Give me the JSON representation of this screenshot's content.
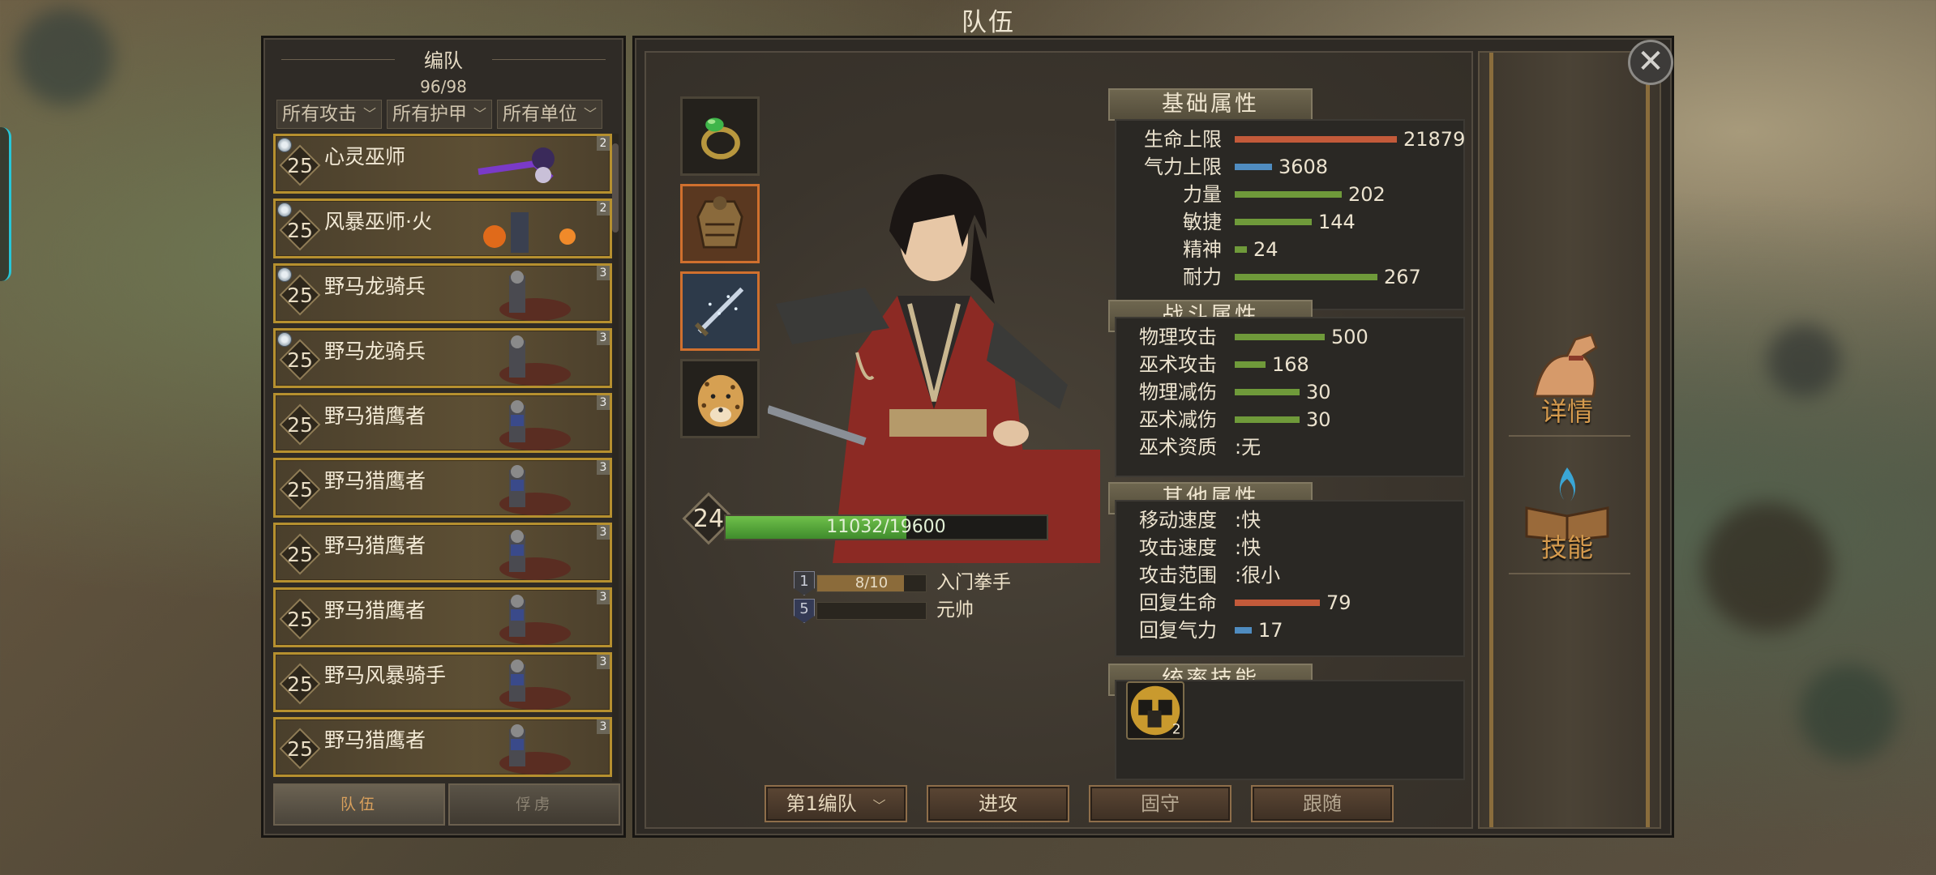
{
  "window_title": "队伍",
  "roster": {
    "title": "编队",
    "count": "96/98",
    "filters": [
      "所有攻击",
      "所有护甲",
      "所有单位"
    ],
    "units": [
      {
        "level": "25",
        "name": "心灵巫师",
        "tier": "2",
        "ranked": true
      },
      {
        "level": "25",
        "name": "风暴巫师·火",
        "tier": "2",
        "ranked": true
      },
      {
        "level": "25",
        "name": "野马龙骑兵",
        "tier": "3",
        "ranked": true
      },
      {
        "level": "25",
        "name": "野马龙骑兵",
        "tier": "3",
        "ranked": true
      },
      {
        "level": "25",
        "name": "野马猎鹰者",
        "tier": "3",
        "ranked": false
      },
      {
        "level": "25",
        "name": "野马猎鹰者",
        "tier": "3",
        "ranked": false
      },
      {
        "level": "25",
        "name": "野马猎鹰者",
        "tier": "3",
        "ranked": false
      },
      {
        "level": "25",
        "name": "野马猎鹰者",
        "tier": "3",
        "ranked": false
      },
      {
        "level": "25",
        "name": "野马风暴骑手",
        "tier": "3",
        "ranked": false
      },
      {
        "level": "25",
        "name": "野马猎鹰者",
        "tier": "3",
        "ranked": false
      }
    ],
    "tabs": [
      "队伍",
      "俘虏"
    ]
  },
  "hero": {
    "level": "24",
    "xp_text": "11032/19600",
    "xp_fraction": 0.563,
    "rank_progress": {
      "icon": "1",
      "value": "8/10",
      "fraction": 0.8,
      "label": "入门拳手"
    },
    "title_progress": {
      "icon": "5",
      "value": "",
      "fraction": 0.0,
      "label": "元帅"
    }
  },
  "equipment": [
    "ring-icon",
    "armor-icon",
    "sword-icon",
    "cheetah-mount-icon"
  ],
  "stats": {
    "basic_title": "基础属性",
    "basic": [
      {
        "label": "生命上限",
        "value": "21879",
        "color": "#c35a3a",
        "fraction": 0.95
      },
      {
        "label": "气力上限",
        "value": "3608",
        "color": "#4f8cc0",
        "fraction": 0.22
      },
      {
        "label": "力量",
        "value": "202",
        "color": "#6f9a3a",
        "fraction": 0.63
      },
      {
        "label": "敏捷",
        "value": "144",
        "color": "#6f9a3a",
        "fraction": 0.45
      },
      {
        "label": "精神",
        "value": "24",
        "color": "#6f9a3a",
        "fraction": 0.07
      },
      {
        "label": "耐力",
        "value": "267",
        "color": "#6f9a3a",
        "fraction": 0.84
      }
    ],
    "combat_title": "战斗属性",
    "combat": [
      {
        "label": "物理攻击",
        "value": "500",
        "color": "#6f9a3a",
        "fraction": 0.53
      },
      {
        "label": "巫术攻击",
        "value": "168",
        "color": "#6f9a3a",
        "fraction": 0.18
      },
      {
        "label": "物理减伤",
        "value": "30",
        "color": "#6f9a3a",
        "fraction": 0.38
      },
      {
        "label": "巫术减伤",
        "value": "30",
        "color": "#6f9a3a",
        "fraction": 0.38
      },
      {
        "label": "巫术资质",
        "value": ":无",
        "text_only": true
      }
    ],
    "other_title": "其他属性",
    "other": [
      {
        "label": "移动速度",
        "value": ":快",
        "text_only": true
      },
      {
        "label": "攻击速度",
        "value": ":快",
        "text_only": true
      },
      {
        "label": "攻击范围",
        "value": ":很小",
        "text_only": true
      },
      {
        "label": "回复生命",
        "value": "79",
        "color": "#c35a3a",
        "fraction": 0.5
      },
      {
        "label": "回复气力",
        "value": "17",
        "color": "#4f8cc0",
        "fraction": 0.1
      }
    ],
    "command_title": "统率技能"
  },
  "command_skill": {
    "icon": "troop-skill-icon",
    "badge": "2"
  },
  "buttons": {
    "formation": "第1编队",
    "attack": "进攻",
    "hold": "固守",
    "follow": "跟随"
  },
  "side": {
    "details": "详情",
    "skills": "技能"
  }
}
